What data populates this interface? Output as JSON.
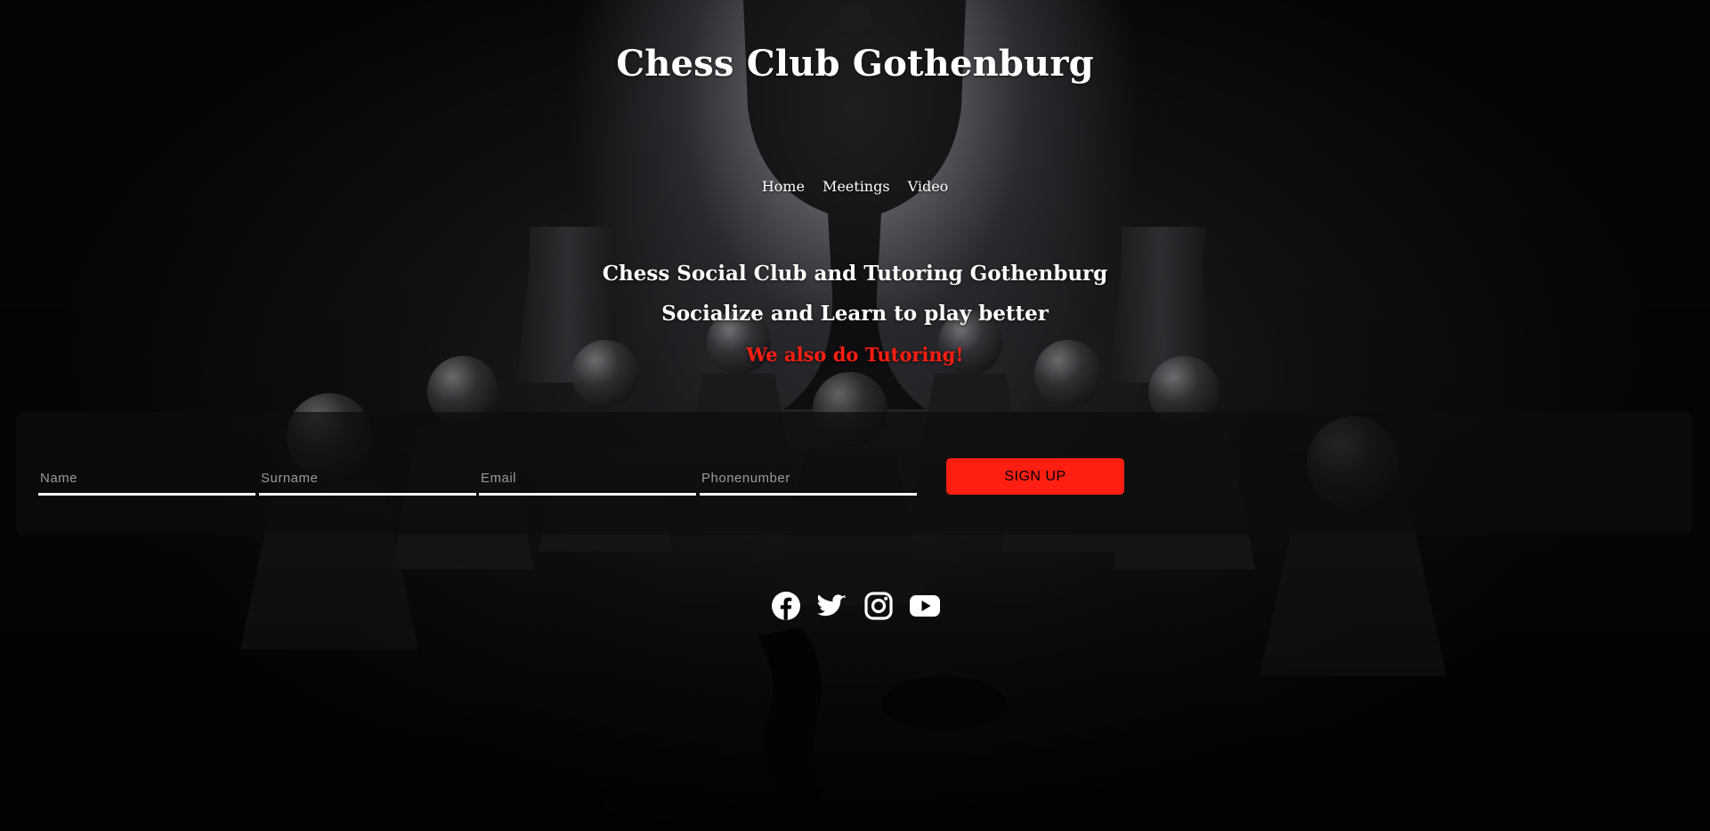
{
  "site": {
    "title": "Chess Club Gothenburg"
  },
  "nav": {
    "items": [
      {
        "label": "Home"
      },
      {
        "label": "Meetings"
      },
      {
        "label": "Video"
      }
    ]
  },
  "hero": {
    "line1": "Chess Social Club and Tutoring Gothenburg",
    "line2": "Socialize and Learn to play better",
    "line3": "We also do Tutoring!"
  },
  "signup": {
    "name_placeholder": "Name",
    "surname_placeholder": "Surname",
    "email_placeholder": "Email",
    "phone_placeholder": "Phonenumber",
    "button_label": "SIGN UP"
  },
  "social": {
    "icons": [
      "facebook-icon",
      "twitter-icon",
      "instagram-icon",
      "youtube-icon"
    ]
  },
  "colors": {
    "accent": "#ff1e12",
    "text": "#ffffff",
    "panel": "#0c0c0c"
  }
}
